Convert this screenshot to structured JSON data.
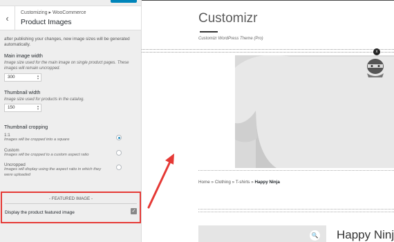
{
  "panel": {
    "breadcrumb": [
      "Customizing",
      "WooCommerce"
    ],
    "breadcrumb_separator": "▸",
    "title": "Product Images",
    "note": "after publishing your changes, new image sizes will be generated automatically.",
    "main_image": {
      "label": "Main image width",
      "description": "Image size used for the main image on single product pages. These images will remain uncropped.",
      "value": "300"
    },
    "thumbnail": {
      "label": "Thumbnail width",
      "description": "Image size used for products in the catalog.",
      "value": "150"
    },
    "cropping": {
      "label": "Thumbnail cropping",
      "options": [
        {
          "title": "1:1",
          "description": "Images will be cropped into a square",
          "checked": true
        },
        {
          "title": "Custom",
          "description": "Images will be cropped to a custom aspect ratio",
          "checked": false
        },
        {
          "title": "Uncropped",
          "description": "Images will display using the aspect ratio in which they were uploaded",
          "checked": false
        }
      ]
    },
    "featured": {
      "title": "- FEATURED IMAGE -",
      "checkbox_label": "Display the product featured image",
      "checked": true
    }
  },
  "preview": {
    "site_title": "Customizr",
    "tagline": "Customizr WordPress Theme (Pro)",
    "breadcrumb": {
      "home": "Home",
      "clothing": "Clothing",
      "tshirts": "T-shirts",
      "current": "Happy Ninja",
      "separator": " » "
    },
    "product_title": "Happy Ninja",
    "dot_badge": "x"
  },
  "colors": {
    "accent": "#0085ba",
    "highlight": "#e53935",
    "radio_checked": "#1e8cbe"
  }
}
